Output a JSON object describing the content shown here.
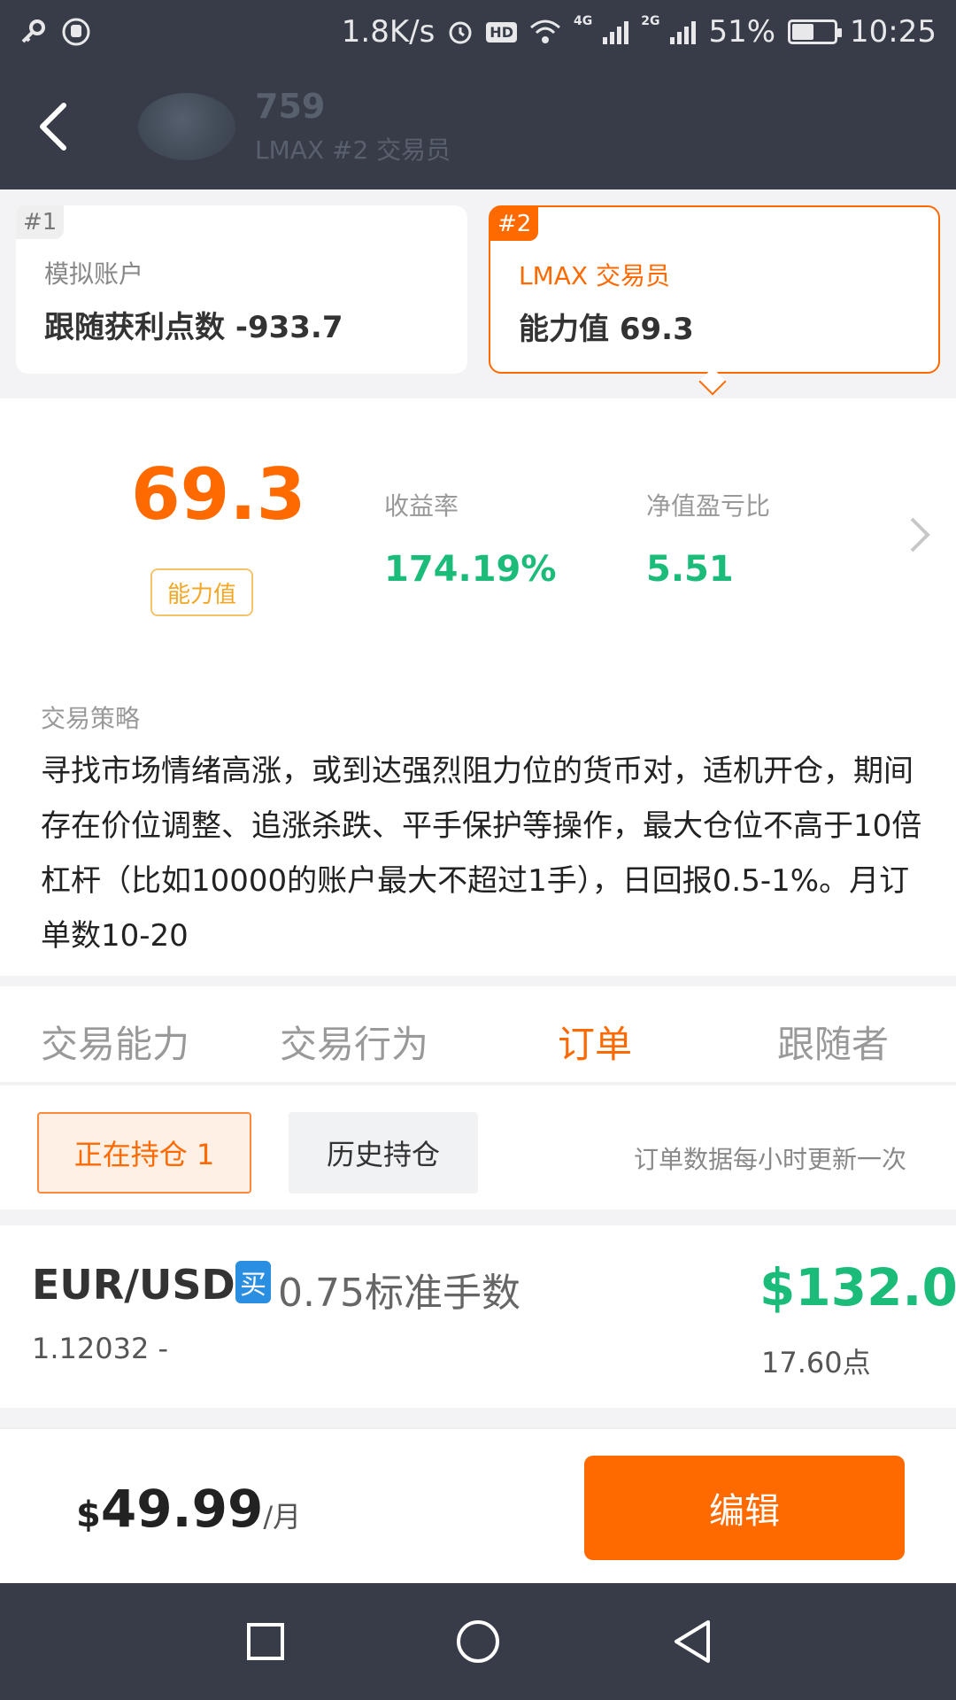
{
  "statusbar": {
    "speed": "1.8K/s",
    "net1": "4G",
    "net2": "2G",
    "battery_pct": "51%",
    "battery_level": 0.51,
    "time": "10:25",
    "hd": "HD"
  },
  "header": {
    "title": "759",
    "subtitle": "LMAX #2 交易员"
  },
  "accounts": [
    {
      "tag": "#1",
      "title": "模拟账户",
      "value": "跟随获利点数 -933.7"
    },
    {
      "tag": "#2",
      "title": "LMAX 交易员",
      "value": "能力值 69.3"
    }
  ],
  "stats": {
    "ability_value": "69.3",
    "ability_label": "能力值",
    "return_label": "收益率",
    "return_value": "174.19%",
    "pnl_ratio_label": "净值盈亏比",
    "pnl_ratio_value": "5.51"
  },
  "strategy": {
    "label": "交易策略",
    "text": "寻找市场情绪高涨，或到达强烈阻力位的货币对，适机开仓，期间存在价位调整、追涨杀跌、平手保护等操作，最大仓位不高于10倍杠杆（比如10000的账户最大不超过1手），日回报0.5-1%。月订单数10-20"
  },
  "tabs": [
    "交易能力",
    "交易行为",
    "订单",
    "跟随者"
  ],
  "subtabs": {
    "open": "正在持仓 1",
    "history": "历史持仓",
    "note": "订单数据每小时更新一次"
  },
  "order": {
    "pair": "EUR/USD",
    "side": "买",
    "lots": "0.75标准手数",
    "price": "1.12032 -",
    "pnl": "$132.0",
    "points": "17.60点"
  },
  "subscription": {
    "currency": "$",
    "amount": "49.99",
    "unit": "/月",
    "edit": "编辑"
  },
  "colors": {
    "accent": "#ff6a00",
    "positive": "#1bbc7a",
    "dark_bar": "#373c48",
    "buy_badge": "#2a8fe0"
  }
}
